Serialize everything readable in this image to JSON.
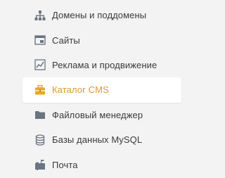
{
  "sidebar": {
    "items": [
      {
        "label": "Домены и поддомены",
        "icon": "sitemap-icon"
      },
      {
        "label": "Сайты",
        "icon": "browser-window-icon"
      },
      {
        "label": "Реклама и продвижение",
        "icon": "chart-line-icon"
      },
      {
        "label": "Каталог CMS",
        "icon": "toolbox-icon",
        "active": true
      },
      {
        "label": "Файловый менеджер",
        "icon": "folder-icon"
      },
      {
        "label": "Базы данных MySQL",
        "icon": "database-icon"
      },
      {
        "label": "Почта",
        "icon": "mailbox-icon"
      }
    ]
  },
  "colors": {
    "background": "#f3f3f3",
    "text": "#3a3a3a",
    "icon": "#6a7583",
    "active_text": "#d89a2e",
    "active_icon": "#e5a733",
    "active_bg": "#ffffff"
  }
}
